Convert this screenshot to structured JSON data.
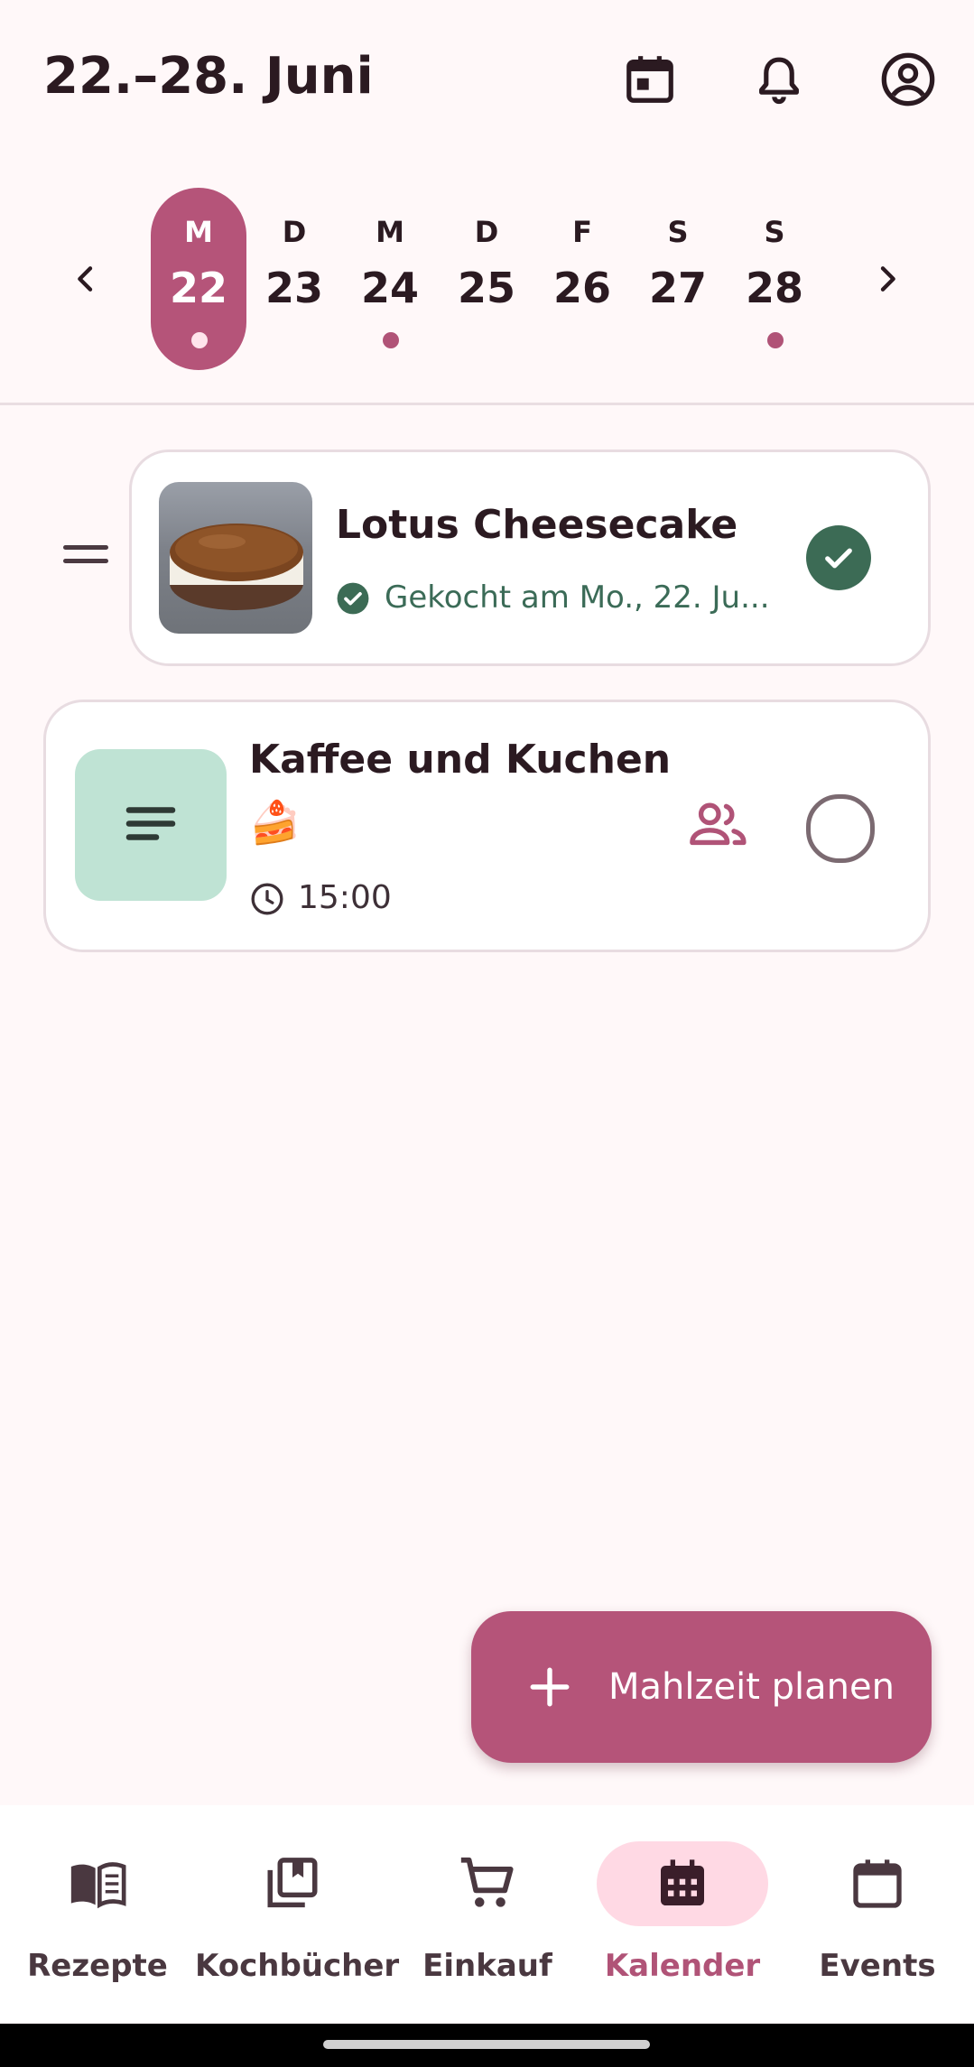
{
  "header": {
    "title": "22.–28. Juni"
  },
  "week": {
    "days": [
      {
        "letter": "M",
        "num": "22",
        "selected": true,
        "dot": true
      },
      {
        "letter": "D",
        "num": "23",
        "selected": false,
        "dot": false
      },
      {
        "letter": "M",
        "num": "24",
        "selected": false,
        "dot": true
      },
      {
        "letter": "D",
        "num": "25",
        "selected": false,
        "dot": false
      },
      {
        "letter": "F",
        "num": "26",
        "selected": false,
        "dot": false
      },
      {
        "letter": "S",
        "num": "27",
        "selected": false,
        "dot": false
      },
      {
        "letter": "S",
        "num": "28",
        "selected": false,
        "dot": true
      }
    ]
  },
  "meals": [
    {
      "title": "Lotus Cheesecake",
      "status": "Gekocht am Mo., 22. Ju...",
      "done": true
    },
    {
      "title": "Kaffee und Kuchen",
      "emoji": "🍰",
      "time": "15:00",
      "done": false
    }
  ],
  "fab": {
    "label": "Mahlzeit planen"
  },
  "nav": {
    "items": [
      {
        "label": "Rezepte",
        "icon": "book-open-icon"
      },
      {
        "label": "Kochbücher",
        "icon": "library-books-icon"
      },
      {
        "label": "Einkauf",
        "icon": "shopping-cart-icon"
      },
      {
        "label": "Kalender",
        "icon": "calendar-month-icon",
        "active": true
      },
      {
        "label": "Events",
        "icon": "event-icon"
      }
    ]
  },
  "colors": {
    "accent": "#B55479",
    "done": "#3C6B55",
    "background": "#FFF8F9"
  }
}
